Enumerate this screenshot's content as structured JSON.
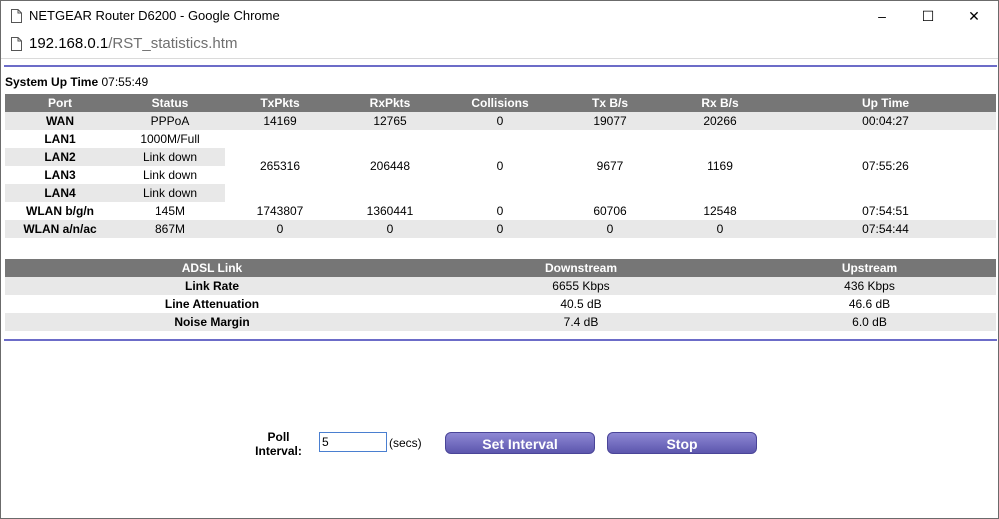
{
  "window": {
    "title": "NETGEAR Router D6200 - Google Chrome",
    "controls": {
      "minimize": "–",
      "maximize": "☐",
      "close": "✕"
    }
  },
  "address_bar": {
    "host": "192.168.0.1",
    "path": "/RST_statistics.htm"
  },
  "system_up_time": {
    "label": "System Up Time",
    "value": "07:55:49"
  },
  "port_table": {
    "headers": [
      "Port",
      "Status",
      "TxPkts",
      "RxPkts",
      "Collisions",
      "Tx B/s",
      "Rx B/s",
      "Up Time"
    ],
    "wan": {
      "port": "WAN",
      "status": "PPPoA",
      "txpkts": "14169",
      "rxpkts": "12765",
      "collisions": "0",
      "txbs": "19077",
      "rxbs": "20266",
      "uptime": "00:04:27"
    },
    "lan": {
      "ports": [
        {
          "port": "LAN1",
          "status": "1000M/Full"
        },
        {
          "port": "LAN2",
          "status": "Link down"
        },
        {
          "port": "LAN3",
          "status": "Link down"
        },
        {
          "port": "LAN4",
          "status": "Link down"
        }
      ],
      "txpkts": "265316",
      "rxpkts": "206448",
      "collisions": "0",
      "txbs": "9677",
      "rxbs": "1169",
      "uptime": "07:55:26"
    },
    "wlan_bgn": {
      "port": "WLAN b/g/n",
      "status": "145M",
      "txpkts": "1743807",
      "rxpkts": "1360441",
      "collisions": "0",
      "txbs": "60706",
      "rxbs": "12548",
      "uptime": "07:54:51"
    },
    "wlan_anac": {
      "port": "WLAN a/n/ac",
      "status": "867M",
      "txpkts": "0",
      "rxpkts": "0",
      "collisions": "0",
      "txbs": "0",
      "rxbs": "0",
      "uptime": "07:54:44"
    }
  },
  "adsl_table": {
    "headers": [
      "ADSL Link",
      "Downstream",
      "Upstream"
    ],
    "rows": [
      {
        "label": "Link Rate",
        "down": "6655 Kbps",
        "up": "436 Kbps"
      },
      {
        "label": "Line Attenuation",
        "down": "40.5 dB",
        "up": "46.6 dB"
      },
      {
        "label": "Noise Margin",
        "down": "7.4 dB",
        "up": "6.0 dB"
      }
    ]
  },
  "poll": {
    "label_line1": "Poll",
    "label_line2": "Interval:",
    "value": "5",
    "unit": "(secs)",
    "set_button": "Set Interval",
    "stop_button": "Stop"
  },
  "colors": {
    "accent_rule": "#6c6cc8",
    "table_header": "#767676",
    "row_stripe": "#e8e8e8",
    "button": "#6f69bd"
  }
}
